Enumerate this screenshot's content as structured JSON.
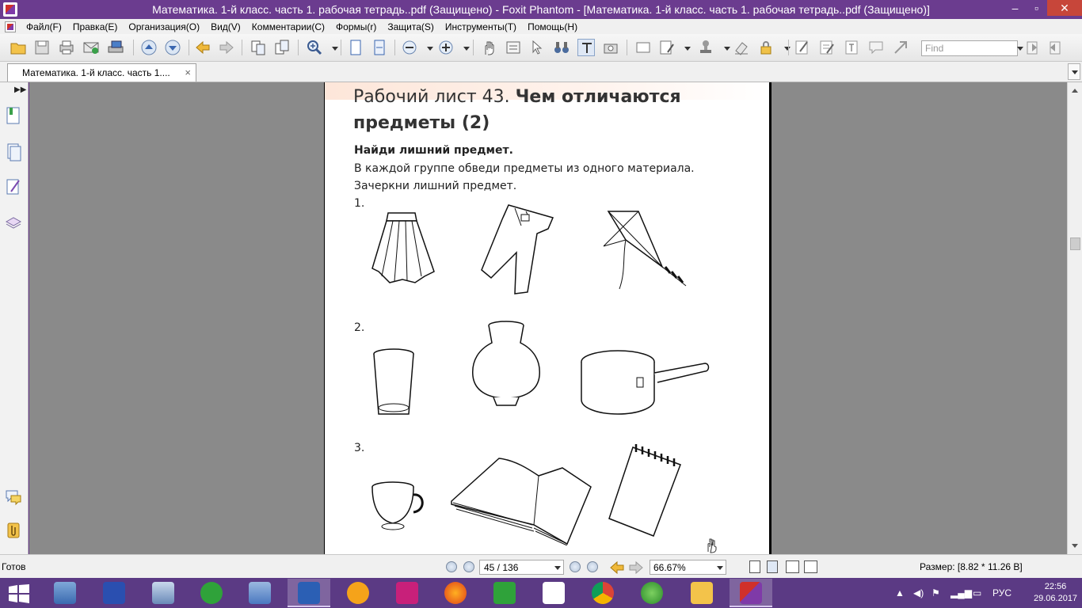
{
  "titlebar": {
    "title": "Математика. 1-й класс. часть 1. рабочая тетрадь..pdf (Защищено) - Foxit Phantom - [Математика. 1-й класс. часть 1. рабочая тетрадь..pdf (Защищено)]",
    "minimize": "–",
    "maximize": "▫",
    "close": "✕"
  },
  "menu": [
    "Файл(F)",
    "Правка(E)",
    "Организация(O)",
    "Вид(V)",
    "Комментарии(C)",
    "Формы(r)",
    "Защита(S)",
    "Инструменты(T)",
    "Помощь(H)"
  ],
  "toolbar": {
    "find_placeholder": "Find"
  },
  "tab": {
    "label": "Математика. 1-й класс. часть 1....",
    "close": "×"
  },
  "document": {
    "title_regular": "Рабочий лист 43.",
    "title_bold_line1": "Чем отличаются",
    "title_bold_line2": "предметы (2)",
    "task_heading": "Найди лишний предмет.",
    "instruction1": "В каждой группе обведи предметы из одного материала.",
    "instruction2": "Зачеркни лишний предмет.",
    "group_labels": [
      "1.",
      "2.",
      "3."
    ]
  },
  "statusbar": {
    "status": "Готов",
    "page_indicator": "45 / 136",
    "zoom": "66.67%",
    "size": "Размер: [8.82 * 11.26 В]"
  },
  "taskbar": {
    "language": "РУС",
    "time": "22:56",
    "date": "29.06.2017"
  },
  "colors": {
    "titlebar": "#6b3c8f",
    "taskbar": "#5b3a84",
    "doc_background": "#8a8a8a"
  }
}
